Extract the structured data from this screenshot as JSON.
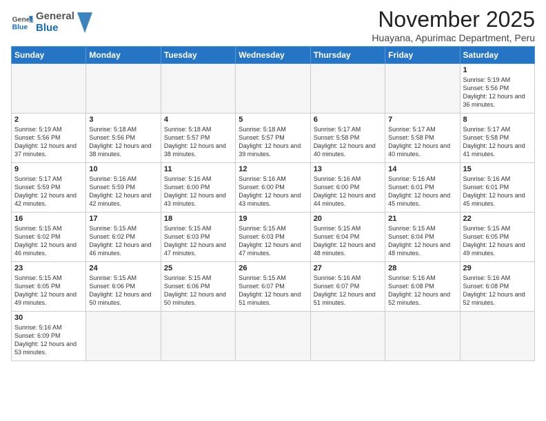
{
  "logo": {
    "text_general": "General",
    "text_blue": "Blue"
  },
  "header": {
    "month": "November 2025",
    "location": "Huayana, Apurimac Department, Peru"
  },
  "weekdays": [
    "Sunday",
    "Monday",
    "Tuesday",
    "Wednesday",
    "Thursday",
    "Friday",
    "Saturday"
  ],
  "weeks": [
    [
      {
        "day": "",
        "info": ""
      },
      {
        "day": "",
        "info": ""
      },
      {
        "day": "",
        "info": ""
      },
      {
        "day": "",
        "info": ""
      },
      {
        "day": "",
        "info": ""
      },
      {
        "day": "",
        "info": ""
      },
      {
        "day": "1",
        "info": "Sunrise: 5:19 AM\nSunset: 5:56 PM\nDaylight: 12 hours and 36 minutes."
      }
    ],
    [
      {
        "day": "2",
        "info": "Sunrise: 5:19 AM\nSunset: 5:56 PM\nDaylight: 12 hours and 37 minutes."
      },
      {
        "day": "3",
        "info": "Sunrise: 5:18 AM\nSunset: 5:56 PM\nDaylight: 12 hours and 38 minutes."
      },
      {
        "day": "4",
        "info": "Sunrise: 5:18 AM\nSunset: 5:57 PM\nDaylight: 12 hours and 38 minutes."
      },
      {
        "day": "5",
        "info": "Sunrise: 5:18 AM\nSunset: 5:57 PM\nDaylight: 12 hours and 39 minutes."
      },
      {
        "day": "6",
        "info": "Sunrise: 5:17 AM\nSunset: 5:58 PM\nDaylight: 12 hours and 40 minutes."
      },
      {
        "day": "7",
        "info": "Sunrise: 5:17 AM\nSunset: 5:58 PM\nDaylight: 12 hours and 40 minutes."
      },
      {
        "day": "8",
        "info": "Sunrise: 5:17 AM\nSunset: 5:58 PM\nDaylight: 12 hours and 41 minutes."
      }
    ],
    [
      {
        "day": "9",
        "info": "Sunrise: 5:17 AM\nSunset: 5:59 PM\nDaylight: 12 hours and 42 minutes."
      },
      {
        "day": "10",
        "info": "Sunrise: 5:16 AM\nSunset: 5:59 PM\nDaylight: 12 hours and 42 minutes."
      },
      {
        "day": "11",
        "info": "Sunrise: 5:16 AM\nSunset: 6:00 PM\nDaylight: 12 hours and 43 minutes."
      },
      {
        "day": "12",
        "info": "Sunrise: 5:16 AM\nSunset: 6:00 PM\nDaylight: 12 hours and 43 minutes."
      },
      {
        "day": "13",
        "info": "Sunrise: 5:16 AM\nSunset: 6:00 PM\nDaylight: 12 hours and 44 minutes."
      },
      {
        "day": "14",
        "info": "Sunrise: 5:16 AM\nSunset: 6:01 PM\nDaylight: 12 hours and 45 minutes."
      },
      {
        "day": "15",
        "info": "Sunrise: 5:16 AM\nSunset: 6:01 PM\nDaylight: 12 hours and 45 minutes."
      }
    ],
    [
      {
        "day": "16",
        "info": "Sunrise: 5:15 AM\nSunset: 6:02 PM\nDaylight: 12 hours and 46 minutes."
      },
      {
        "day": "17",
        "info": "Sunrise: 5:15 AM\nSunset: 6:02 PM\nDaylight: 12 hours and 46 minutes."
      },
      {
        "day": "18",
        "info": "Sunrise: 5:15 AM\nSunset: 6:03 PM\nDaylight: 12 hours and 47 minutes."
      },
      {
        "day": "19",
        "info": "Sunrise: 5:15 AM\nSunset: 6:03 PM\nDaylight: 12 hours and 47 minutes."
      },
      {
        "day": "20",
        "info": "Sunrise: 5:15 AM\nSunset: 6:04 PM\nDaylight: 12 hours and 48 minutes."
      },
      {
        "day": "21",
        "info": "Sunrise: 5:15 AM\nSunset: 6:04 PM\nDaylight: 12 hours and 48 minutes."
      },
      {
        "day": "22",
        "info": "Sunrise: 5:15 AM\nSunset: 6:05 PM\nDaylight: 12 hours and 49 minutes."
      }
    ],
    [
      {
        "day": "23",
        "info": "Sunrise: 5:15 AM\nSunset: 6:05 PM\nDaylight: 12 hours and 49 minutes."
      },
      {
        "day": "24",
        "info": "Sunrise: 5:15 AM\nSunset: 6:06 PM\nDaylight: 12 hours and 50 minutes."
      },
      {
        "day": "25",
        "info": "Sunrise: 5:15 AM\nSunset: 6:06 PM\nDaylight: 12 hours and 50 minutes."
      },
      {
        "day": "26",
        "info": "Sunrise: 5:15 AM\nSunset: 6:07 PM\nDaylight: 12 hours and 51 minutes."
      },
      {
        "day": "27",
        "info": "Sunrise: 5:16 AM\nSunset: 6:07 PM\nDaylight: 12 hours and 51 minutes."
      },
      {
        "day": "28",
        "info": "Sunrise: 5:16 AM\nSunset: 6:08 PM\nDaylight: 12 hours and 52 minutes."
      },
      {
        "day": "29",
        "info": "Sunrise: 5:16 AM\nSunset: 6:08 PM\nDaylight: 12 hours and 52 minutes."
      }
    ],
    [
      {
        "day": "30",
        "info": "Sunrise: 5:16 AM\nSunset: 6:09 PM\nDaylight: 12 hours and 53 minutes."
      },
      {
        "day": "",
        "info": ""
      },
      {
        "day": "",
        "info": ""
      },
      {
        "day": "",
        "info": ""
      },
      {
        "day": "",
        "info": ""
      },
      {
        "day": "",
        "info": ""
      },
      {
        "day": "",
        "info": ""
      }
    ]
  ]
}
